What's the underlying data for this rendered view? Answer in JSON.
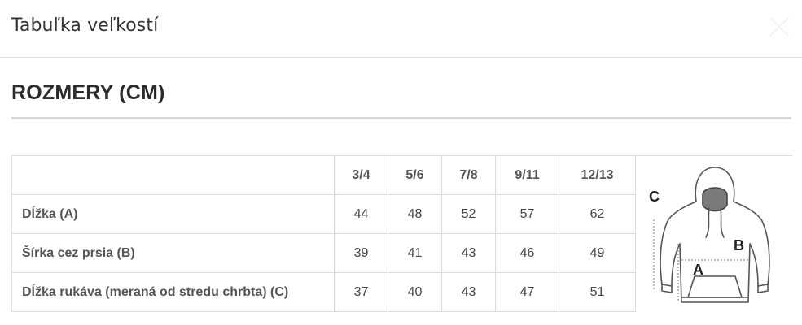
{
  "modal": {
    "title": "Tabuľka veľkostí",
    "close_icon": "close-icon"
  },
  "section": {
    "heading": "ROZMERY (CM)"
  },
  "table": {
    "columns": [
      "3/4",
      "5/6",
      "7/8",
      "9/11",
      "12/13"
    ],
    "rows": [
      {
        "label": "Dĺžka (A)",
        "values": [
          "44",
          "48",
          "52",
          "57",
          "62"
        ]
      },
      {
        "label": "Šírka cez prsia (B)",
        "values": [
          "39",
          "41",
          "43",
          "46",
          "49"
        ]
      },
      {
        "label": "Dĺžka rukáva (meraná od stredu chrbta) (C)",
        "values": [
          "37",
          "40",
          "43",
          "47",
          "51"
        ]
      }
    ]
  },
  "diagram": {
    "icon": "hoodie-measurement-icon",
    "label_a": "A",
    "label_b": "B",
    "label_c": "C"
  }
}
